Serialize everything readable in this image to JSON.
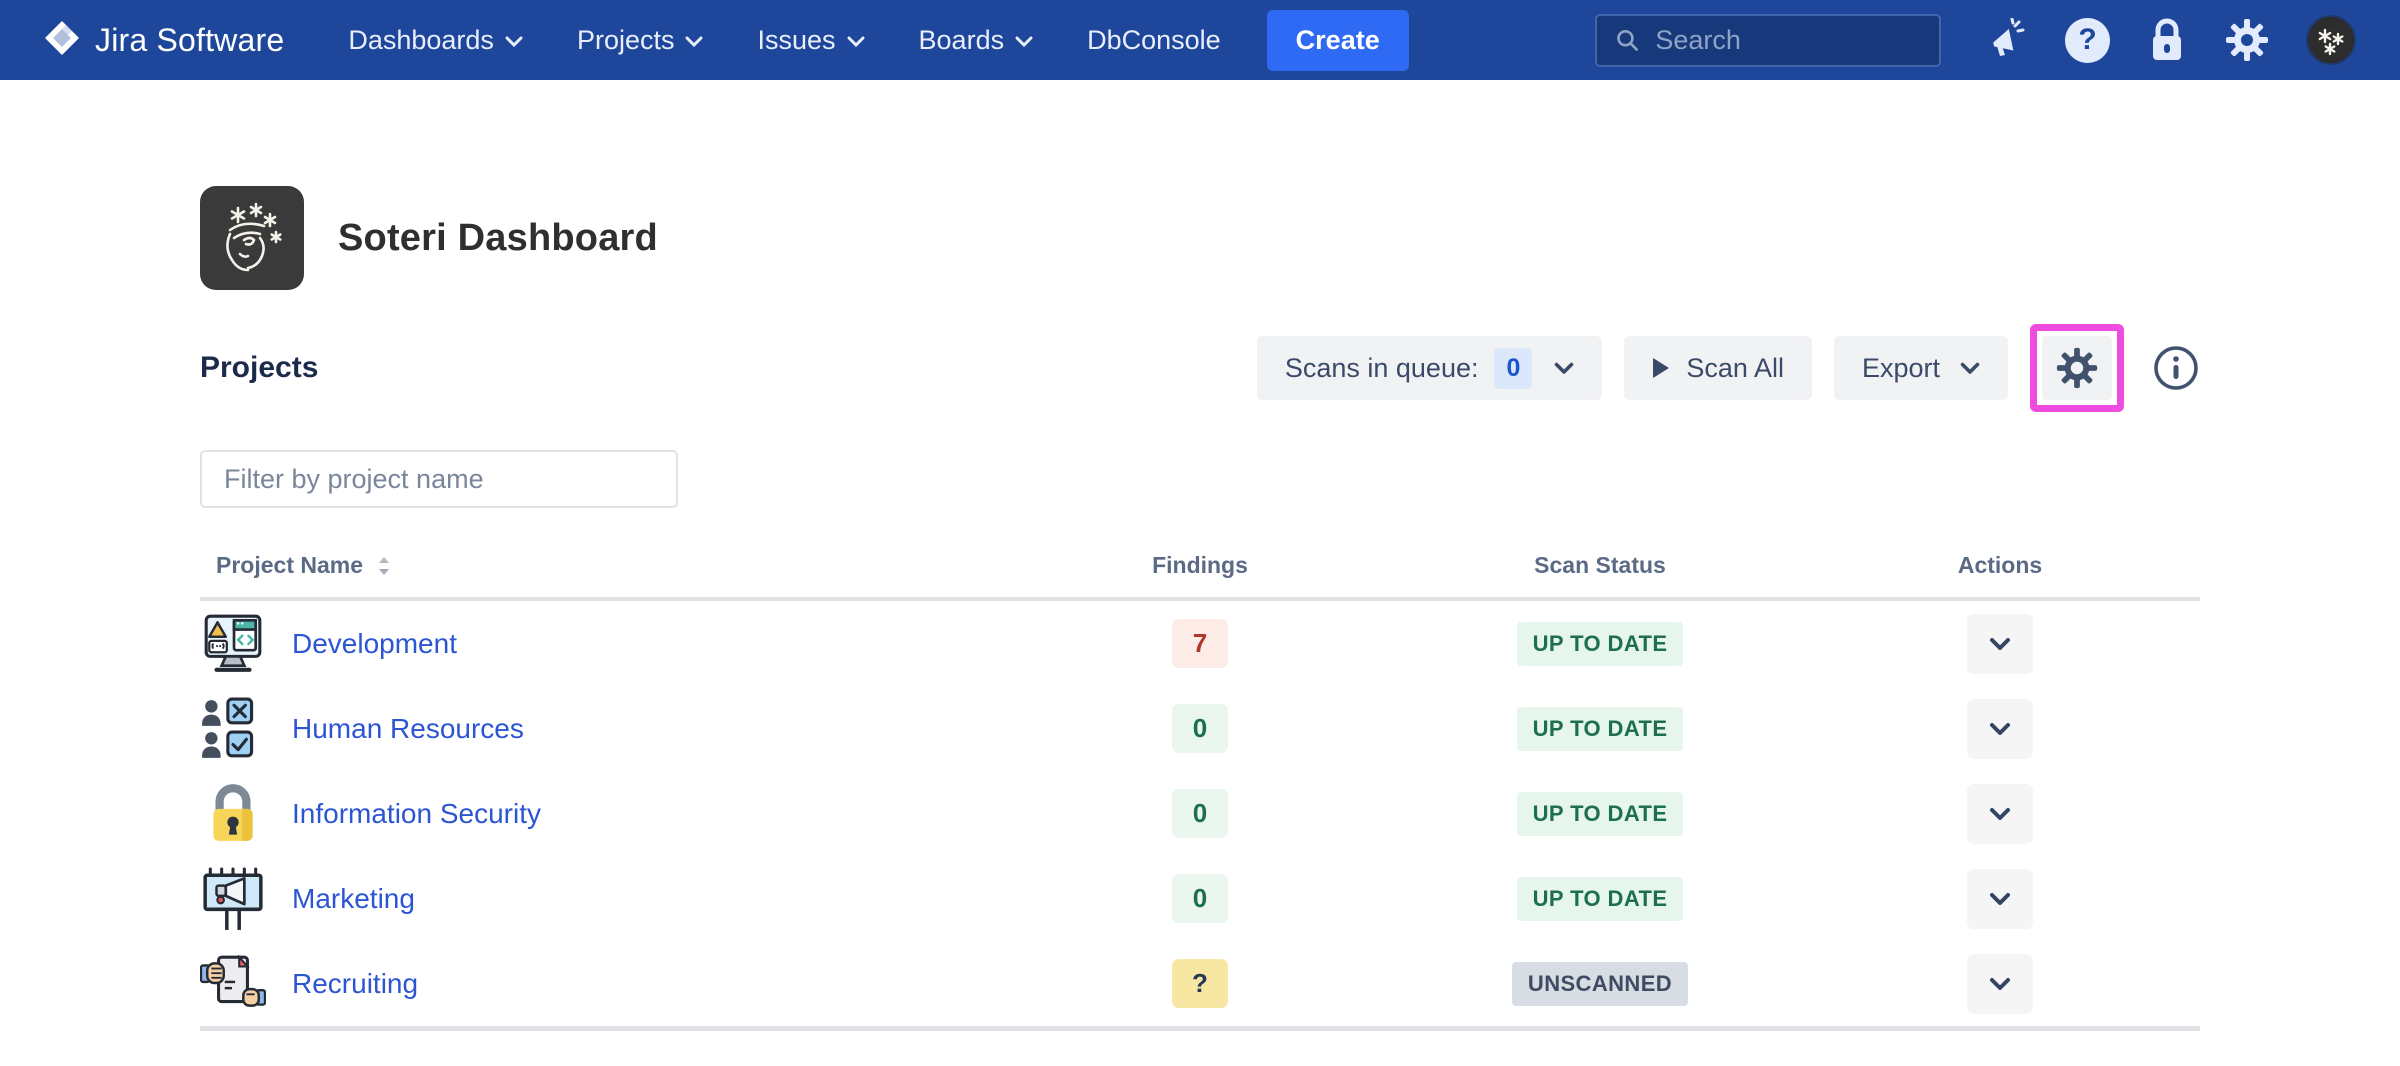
{
  "nav": {
    "brand": "Jira Software",
    "items": [
      {
        "label": "Dashboards"
      },
      {
        "label": "Projects"
      },
      {
        "label": "Issues"
      },
      {
        "label": "Boards"
      },
      {
        "label": "DbConsole"
      }
    ],
    "create_label": "Create",
    "search_placeholder": "Search",
    "help_glyph": "?",
    "icons": [
      "announcement-icon",
      "help-icon",
      "lock-icon",
      "settings-icon",
      "user-avatar"
    ]
  },
  "header": {
    "title": "Soteri Dashboard",
    "app_icon": "soteri-logo"
  },
  "section": {
    "title": "Projects"
  },
  "toolbar": {
    "scans_in_queue_label": "Scans in queue:",
    "scans_in_queue_count": "0",
    "scan_all_label": "Scan All",
    "export_label": "Export"
  },
  "filter": {
    "placeholder": "Filter by project name",
    "value": ""
  },
  "table": {
    "columns": [
      "Project Name",
      "Findings",
      "Scan Status",
      "Actions"
    ],
    "rows": [
      {
        "name": "Development",
        "icon": "development-avatar",
        "findings": "7",
        "findings_variant": "f-red",
        "status": "UP TO DATE",
        "status_variant": "s-green"
      },
      {
        "name": "Human Resources",
        "icon": "human-resources-avatar",
        "findings": "0",
        "findings_variant": "f-green",
        "status": "UP TO DATE",
        "status_variant": "s-green"
      },
      {
        "name": "Information Security",
        "icon": "security-lock-avatar",
        "findings": "0",
        "findings_variant": "f-green",
        "status": "UP TO DATE",
        "status_variant": "s-green"
      },
      {
        "name": "Marketing",
        "icon": "marketing-avatar",
        "findings": "0",
        "findings_variant": "f-green",
        "status": "UP TO DATE",
        "status_variant": "s-green"
      },
      {
        "name": "Recruiting",
        "icon": "recruiting-avatar",
        "findings": "?",
        "findings_variant": "f-yellow",
        "status": "UNSCANNED",
        "status_variant": "s-gray"
      }
    ]
  },
  "colors": {
    "navbar": "#1e479b",
    "create_button": "#2e6af3",
    "link": "#2c55d4",
    "highlight": "#ee4ce0",
    "status_green_text": "#1d6f50",
    "findings_red_text": "#ae382b"
  }
}
